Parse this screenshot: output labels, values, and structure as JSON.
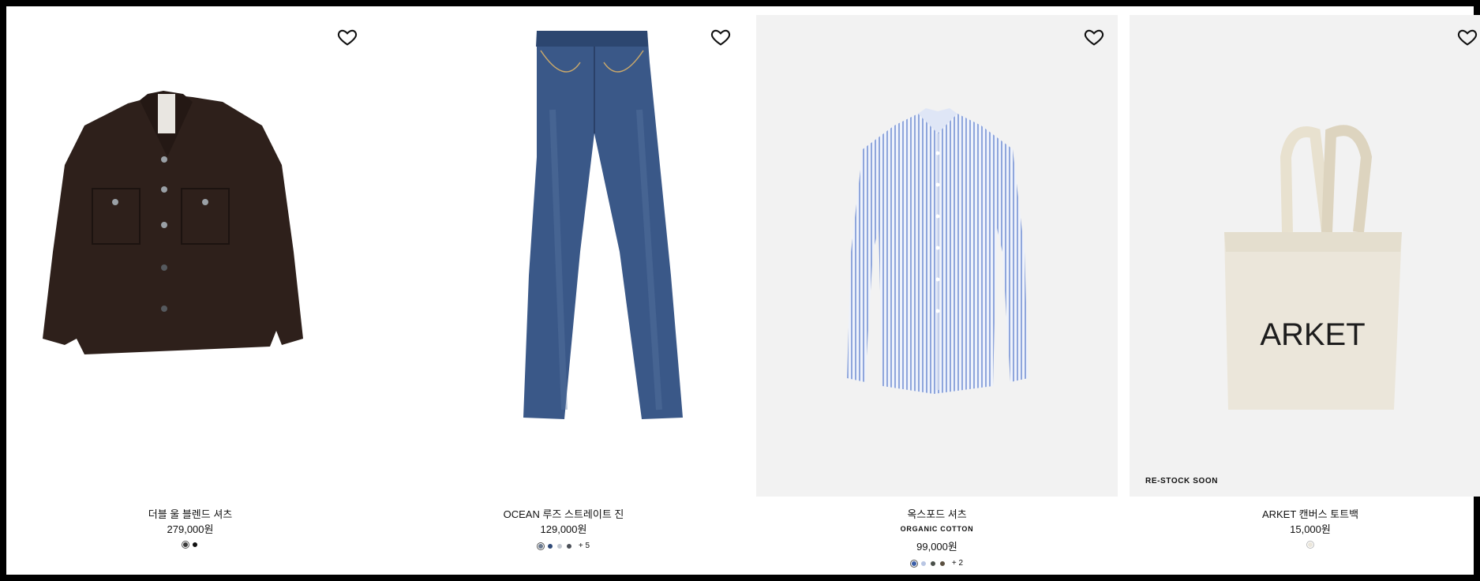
{
  "products": [
    {
      "name": "더블 울 블렌드 셔츠",
      "price": "279,000원",
      "swatches": [
        "#3a3a3a",
        "#111111"
      ],
      "more": "",
      "icon": "heart-icon"
    },
    {
      "name": "OCEAN 루즈 스트레이트 진",
      "price": "129,000원",
      "swatches": [
        "#6b7a8f",
        "#2f4a78",
        "#c4c9d1",
        "#4a4f57"
      ],
      "more": "+ 5",
      "icon": "heart-icon"
    },
    {
      "name": "옥스포드 셔츠",
      "tag": "ORGANIC COTTON",
      "price": "99,000원",
      "swatches": [
        "#3b5ea8",
        "#b9c6e3",
        "#4a4f4a",
        "#5a5040"
      ],
      "more": "+ 2",
      "icon": "heart-icon"
    },
    {
      "name": "ARKET 캔버스 토트백",
      "price": "15,000원",
      "badge": "RE-STOCK SOON",
      "bag_print": "ARKET",
      "swatches": [
        "#ebe6da"
      ],
      "more": "",
      "icon": "heart-icon"
    }
  ]
}
